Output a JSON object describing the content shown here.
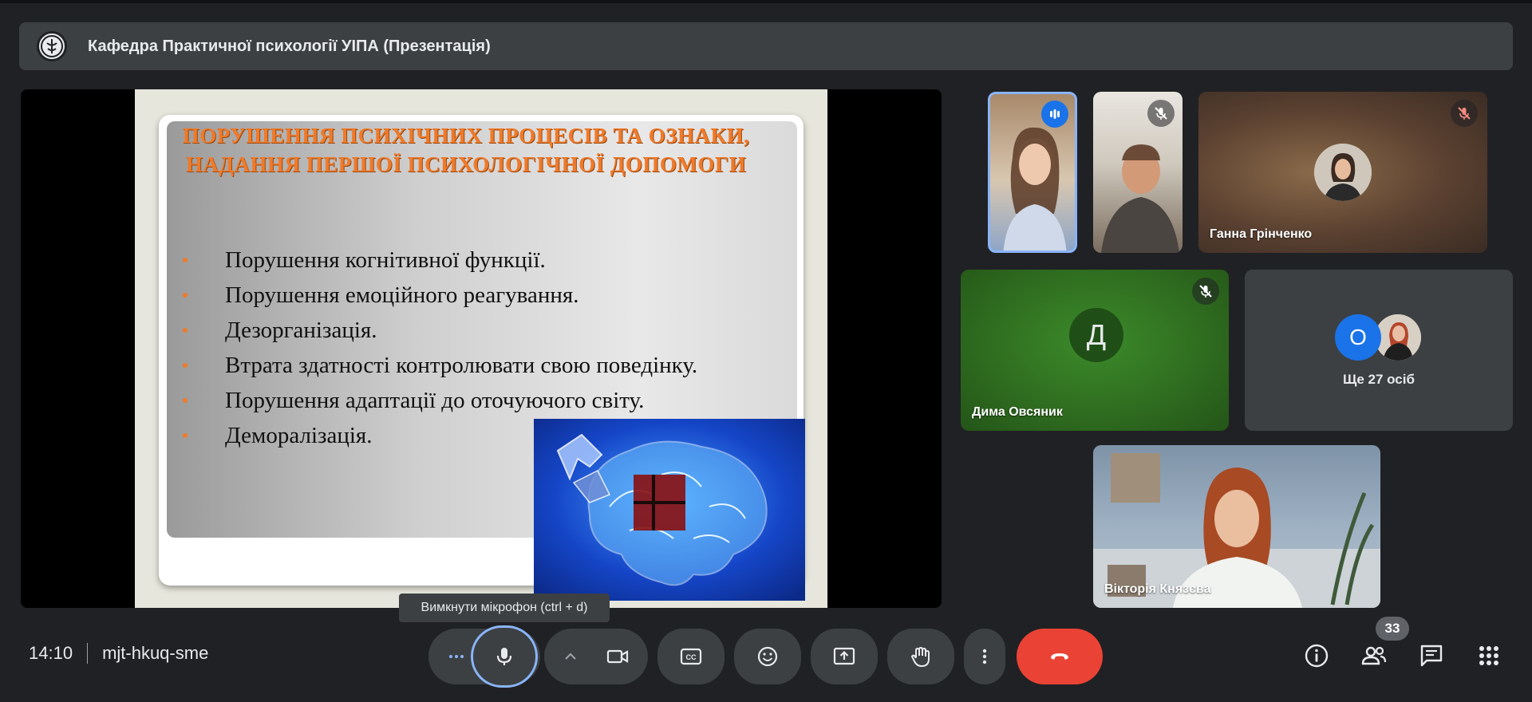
{
  "meeting": {
    "banner_title": "Кафедра Практичної психології УІПА (Презентація)",
    "time": "14:10",
    "code": "mjt-hkuq-sme",
    "participant_count": "33"
  },
  "slide": {
    "heading_line1": "ПОРУШЕННЯ ПСИХІЧНИХ ПРОЦЕСІВ ТА ОЗНАКИ,",
    "heading_line2": "НАДАННЯ ПЕРШОЇ ПСИХОЛОГІЧНОЇ ДОПОМОГИ",
    "bullets": [
      "Порушення когнітивної функції.",
      "Порушення емоційного реагування.",
      "Дезорганізація.",
      "Втрата здатності контролювати свою поведінку.",
      "Порушення адаптації до оточуючого світу.",
      "Деморалізація."
    ]
  },
  "participants": {
    "tile_ganna": {
      "name": "Ганна Грінченко",
      "muted": true
    },
    "tile_dyma": {
      "name": "Дима Овсяник",
      "initial": "Д",
      "muted": true
    },
    "tile_others": {
      "label": "Ще 27 осіб",
      "avatar_initial": "О"
    },
    "tile_viktoria": {
      "name": "Вікторія Князєва"
    },
    "tile_speaker": {
      "speaking": true
    },
    "tile_man": {
      "muted": true
    }
  },
  "tooltip": "Вимкнути мікрофон (ctrl + d)",
  "colors": {
    "background": "#202124",
    "end_call": "#ea4335",
    "active_outline": "#8ab4f8",
    "dyma_tile": "#2e6b1f",
    "others_avatar": "#1a73e8"
  },
  "icons": {
    "more_options": "three-dots-horizontal",
    "mic": "microphone",
    "camera_options": "chevron-up",
    "camera": "video-camera",
    "captions": "closed-captions",
    "reactions": "emoji",
    "present": "present-screen",
    "raise_hand": "hand",
    "more": "three-dots-vertical",
    "end_call": "phone-hangup",
    "info": "info",
    "people": "people",
    "chat": "chat",
    "activities": "grid"
  }
}
